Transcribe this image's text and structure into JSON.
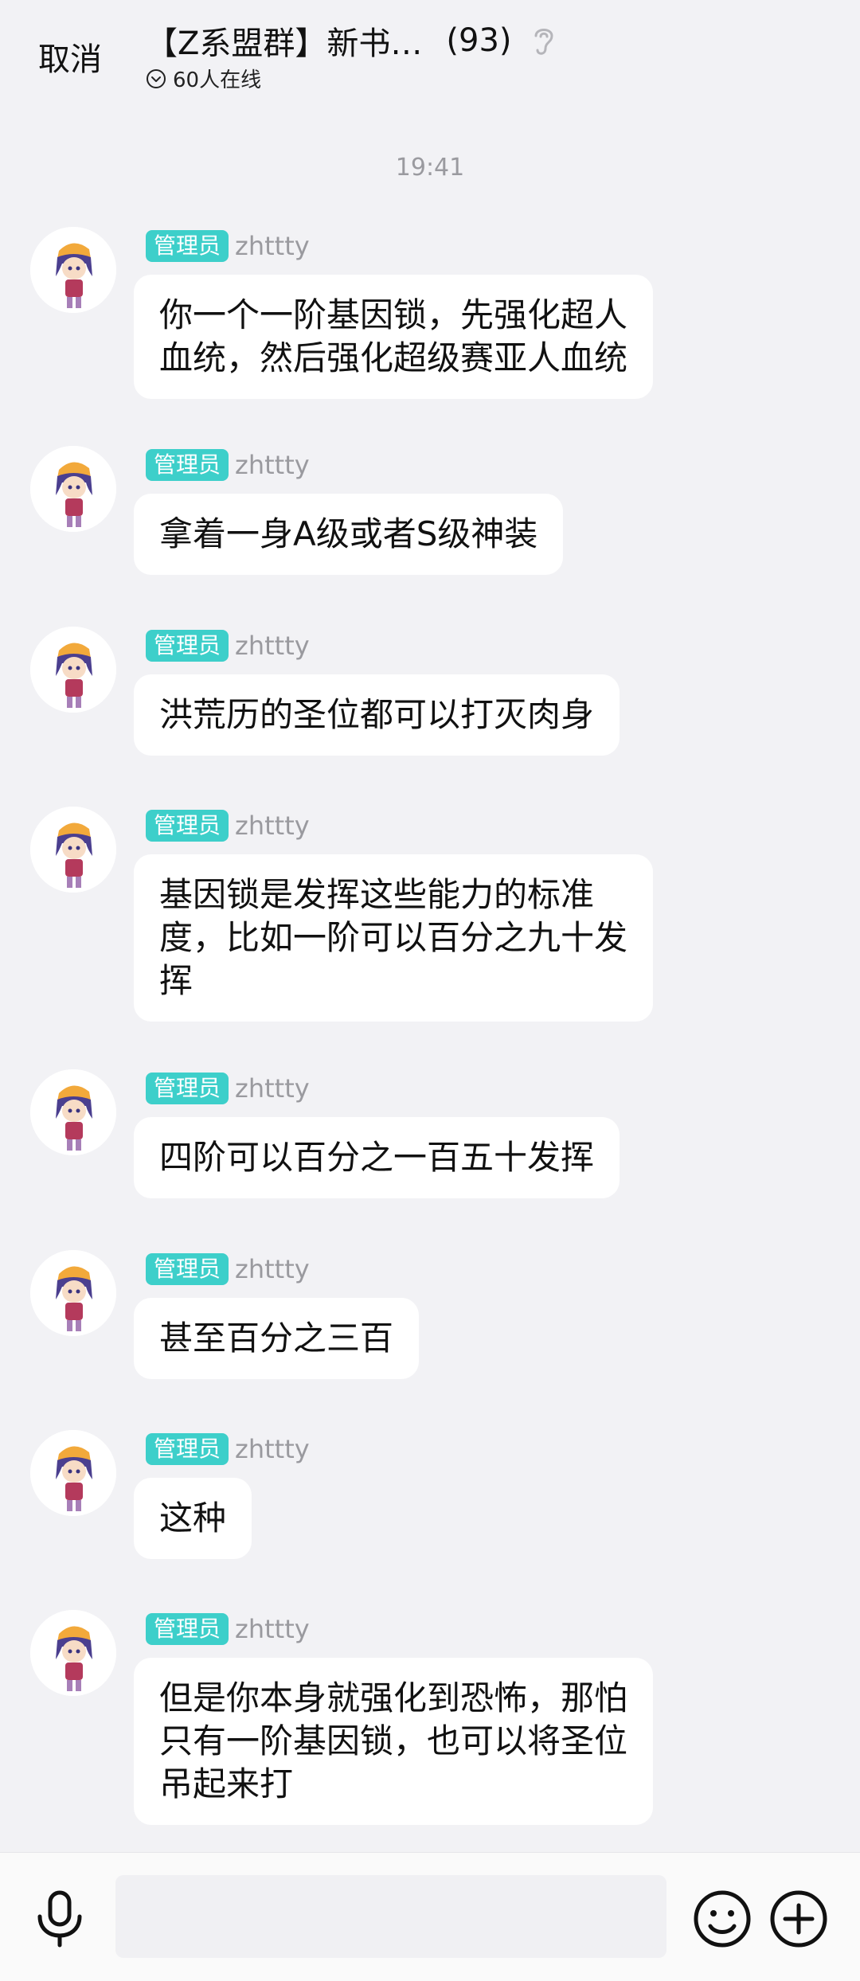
{
  "header": {
    "cancel_label": "取消",
    "group_title": "【Z系盟群】新书…",
    "member_count": "(93)",
    "online_text": "60人在线",
    "ear_icon": "ear-icon",
    "online_icon": "chevron-down-circle-icon"
  },
  "timestamp": "19:41",
  "messages": [
    {
      "badge": "管理员",
      "nick": "zhttty",
      "lines": [
        "你一个一阶基因锁，先强化超人",
        "血统，然后强化超级赛亚人血统"
      ]
    },
    {
      "badge": "管理员",
      "nick": "zhttty",
      "lines": [
        "拿着一身A级或者S级神装"
      ]
    },
    {
      "badge": "管理员",
      "nick": "zhttty",
      "lines": [
        "洪荒历的圣位都可以打灭肉身"
      ]
    },
    {
      "badge": "管理员",
      "nick": "zhttty",
      "lines": [
        "基因锁是发挥这些能力的标准",
        "度，比如一阶可以百分之九十发",
        "挥"
      ]
    },
    {
      "badge": "管理员",
      "nick": "zhttty",
      "lines": [
        "四阶可以百分之一百五十发挥"
      ]
    },
    {
      "badge": "管理员",
      "nick": "zhttty",
      "lines": [
        "甚至百分之三百"
      ]
    },
    {
      "badge": "管理员",
      "nick": "zhttty",
      "lines": [
        "这种"
      ]
    },
    {
      "badge": "管理员",
      "nick": "zhttty",
      "lines": [
        "但是你本身就强化到恐怖，那怕",
        "只有一阶基因锁，也可以将圣位",
        "吊起来打"
      ]
    }
  ],
  "input_bar": {
    "input_value": "",
    "icons": [
      "microphone-icon",
      "emoji-icon",
      "plus-icon"
    ]
  },
  "colors": {
    "background": "#f2f2f5",
    "badge": "#3dcfca",
    "bubble": "#ffffff",
    "nick": "#9a9a9f"
  }
}
